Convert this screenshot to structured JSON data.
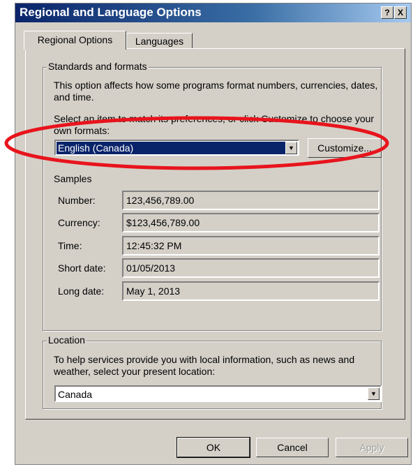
{
  "window": {
    "title": "Regional and Language Options"
  },
  "titlebar_buttons": {
    "help": "?",
    "close": "X"
  },
  "tabs": [
    {
      "label": "Regional Options"
    },
    {
      "label": "Languages"
    }
  ],
  "standards": {
    "group_label": "Standards and formats",
    "description": "This option affects how some programs format numbers, currencies, dates, and time.",
    "select_prompt": "Select an item to match its preferences, or click Customize to choose your own formats:",
    "selected_format": "English (Canada)",
    "customize_label": "Customize..."
  },
  "samples": {
    "label": "Samples",
    "rows": [
      {
        "label": "Number:",
        "value": "123,456,789.00"
      },
      {
        "label": "Currency:",
        "value": "$123,456,789.00"
      },
      {
        "label": "Time:",
        "value": "12:45:32 PM"
      },
      {
        "label": "Short date:",
        "value": "01/05/2013"
      },
      {
        "label": "Long date:",
        "value": "May 1, 2013"
      }
    ]
  },
  "location": {
    "group_label": "Location",
    "description": "To help services provide you with local information, such as news and weather, select your present location:",
    "selected": "Canada"
  },
  "footer": {
    "ok": "OK",
    "cancel": "Cancel",
    "apply": "Apply"
  },
  "annotation": {
    "color": "#e8141c"
  }
}
